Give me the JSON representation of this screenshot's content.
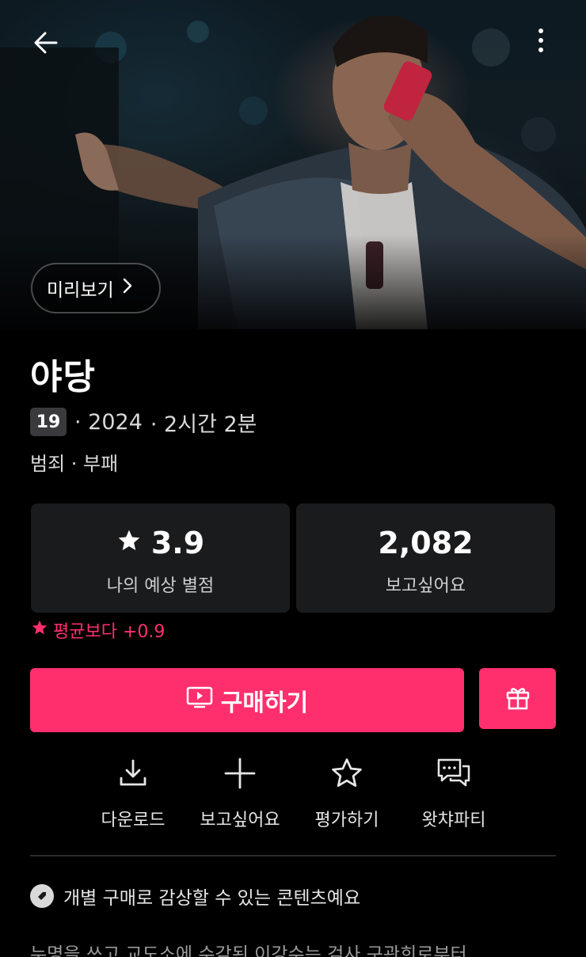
{
  "header": {
    "back_icon": "arrow-left-icon",
    "more_icon": "more-vertical-icon"
  },
  "hero": {
    "preview_label": "미리보기",
    "preview_icon": "chevron-right-icon"
  },
  "movie": {
    "title": "야당",
    "age_rating": "19",
    "meta_year": "· 2024",
    "meta_runtime": "· 2시간 2분",
    "genres": "범죄 · 부패"
  },
  "stats": {
    "predicted_rating_value": "3.9",
    "predicted_rating_label": "나의 예상 별점",
    "wishlist_count": "2,082",
    "wishlist_label": "보고싶어요",
    "compare_text": "평균보다 +0.9"
  },
  "purchase": {
    "buy_label": "구매하기",
    "gift_icon": "gift-icon"
  },
  "actions": [
    {
      "label": "다운로드",
      "icon": "download-icon"
    },
    {
      "label": "보고싶어요",
      "icon": "plus-icon"
    },
    {
      "label": "평가하기",
      "icon": "star-outline-icon"
    },
    {
      "label": "왓챠파티",
      "icon": "chat-bubbles-icon"
    }
  ],
  "notice": {
    "text": "개별 구매로 감상할 수 있는 콘텐츠예요",
    "icon": "ticket-icon"
  },
  "synopsis": {
    "text": "누명을 쓰고 교도소에 수감된 이강수는 검사 구관희로부터"
  },
  "colors": {
    "accent": "#ff2f6e",
    "card_bg": "#1a1b1d",
    "background": "#000000"
  }
}
